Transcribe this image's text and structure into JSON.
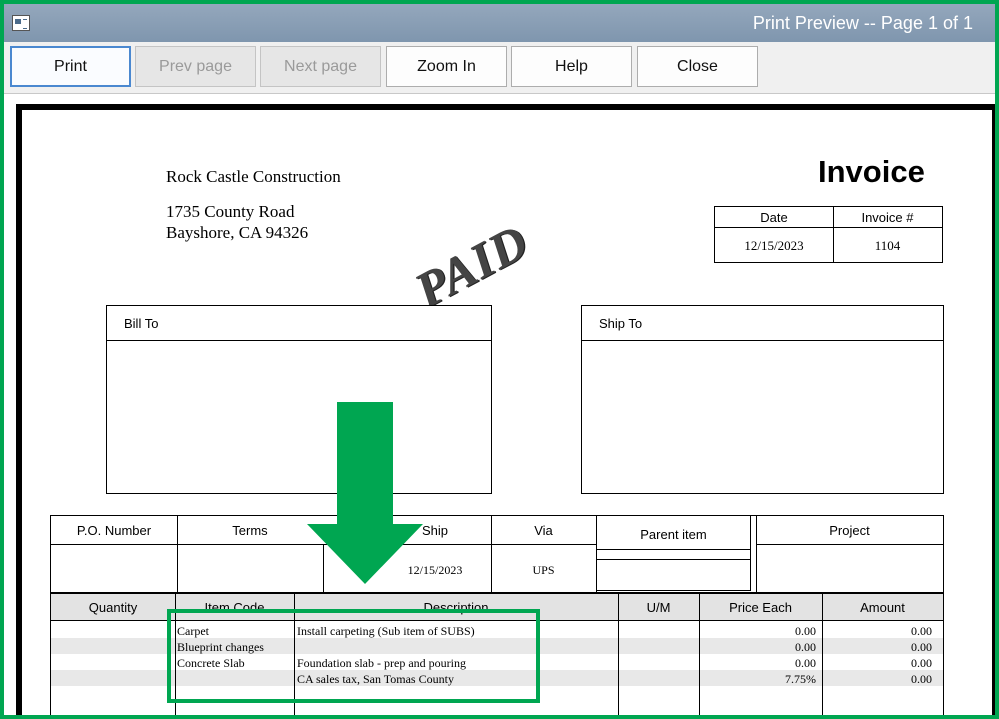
{
  "window": {
    "title": "Print Preview -- Page 1 of 1"
  },
  "toolbar": {
    "print": "Print",
    "prev_page": "Prev page",
    "next_page": "Next page",
    "zoom_in": "Zoom In",
    "help": "Help",
    "close": "Close"
  },
  "invoice": {
    "company": {
      "name": "Rock Castle Construction",
      "address1": "1735 County Road",
      "address2": "Bayshore, CA 94326"
    },
    "heading": "Invoice",
    "stamp": "PAID",
    "meta": {
      "date_label": "Date",
      "number_label": "Invoice #",
      "date": "12/15/2023",
      "number": "1104"
    },
    "bill_to_label": "Bill To",
    "ship_to_label": "Ship To",
    "info_headers": {
      "po": "P.O. Number",
      "terms": "Terms",
      "ship": "Ship",
      "via": "Via",
      "parent": "Parent item",
      "project": "Project"
    },
    "info_values": {
      "ship": "12/15/2023",
      "via": "UPS"
    },
    "line_headers": {
      "quantity": "Quantity",
      "item_code": "Item Code",
      "description": "Description",
      "um": "U/M",
      "price_each": "Price Each",
      "amount": "Amount"
    },
    "lines": [
      {
        "item": "Carpet",
        "description": "Install carpeting (Sub item of SUBS)",
        "price": "0.00",
        "amount": "0.00"
      },
      {
        "item": "Blueprint changes",
        "description": "",
        "price": "0.00",
        "amount": "0.00"
      },
      {
        "item": "Concrete Slab",
        "description": "Foundation slab - prep and pouring",
        "price": "0.00",
        "amount": "0.00"
      },
      {
        "item": "",
        "description": "CA sales tax, San Tomas County",
        "price": "7.75%",
        "amount": "0.00"
      }
    ]
  },
  "colors": {
    "annotation_green": "#00a651",
    "titlebar": "#8a9fb6"
  },
  "icons": {
    "app": "print-preview-window-icon",
    "annotation": "green-down-arrow-icon"
  }
}
